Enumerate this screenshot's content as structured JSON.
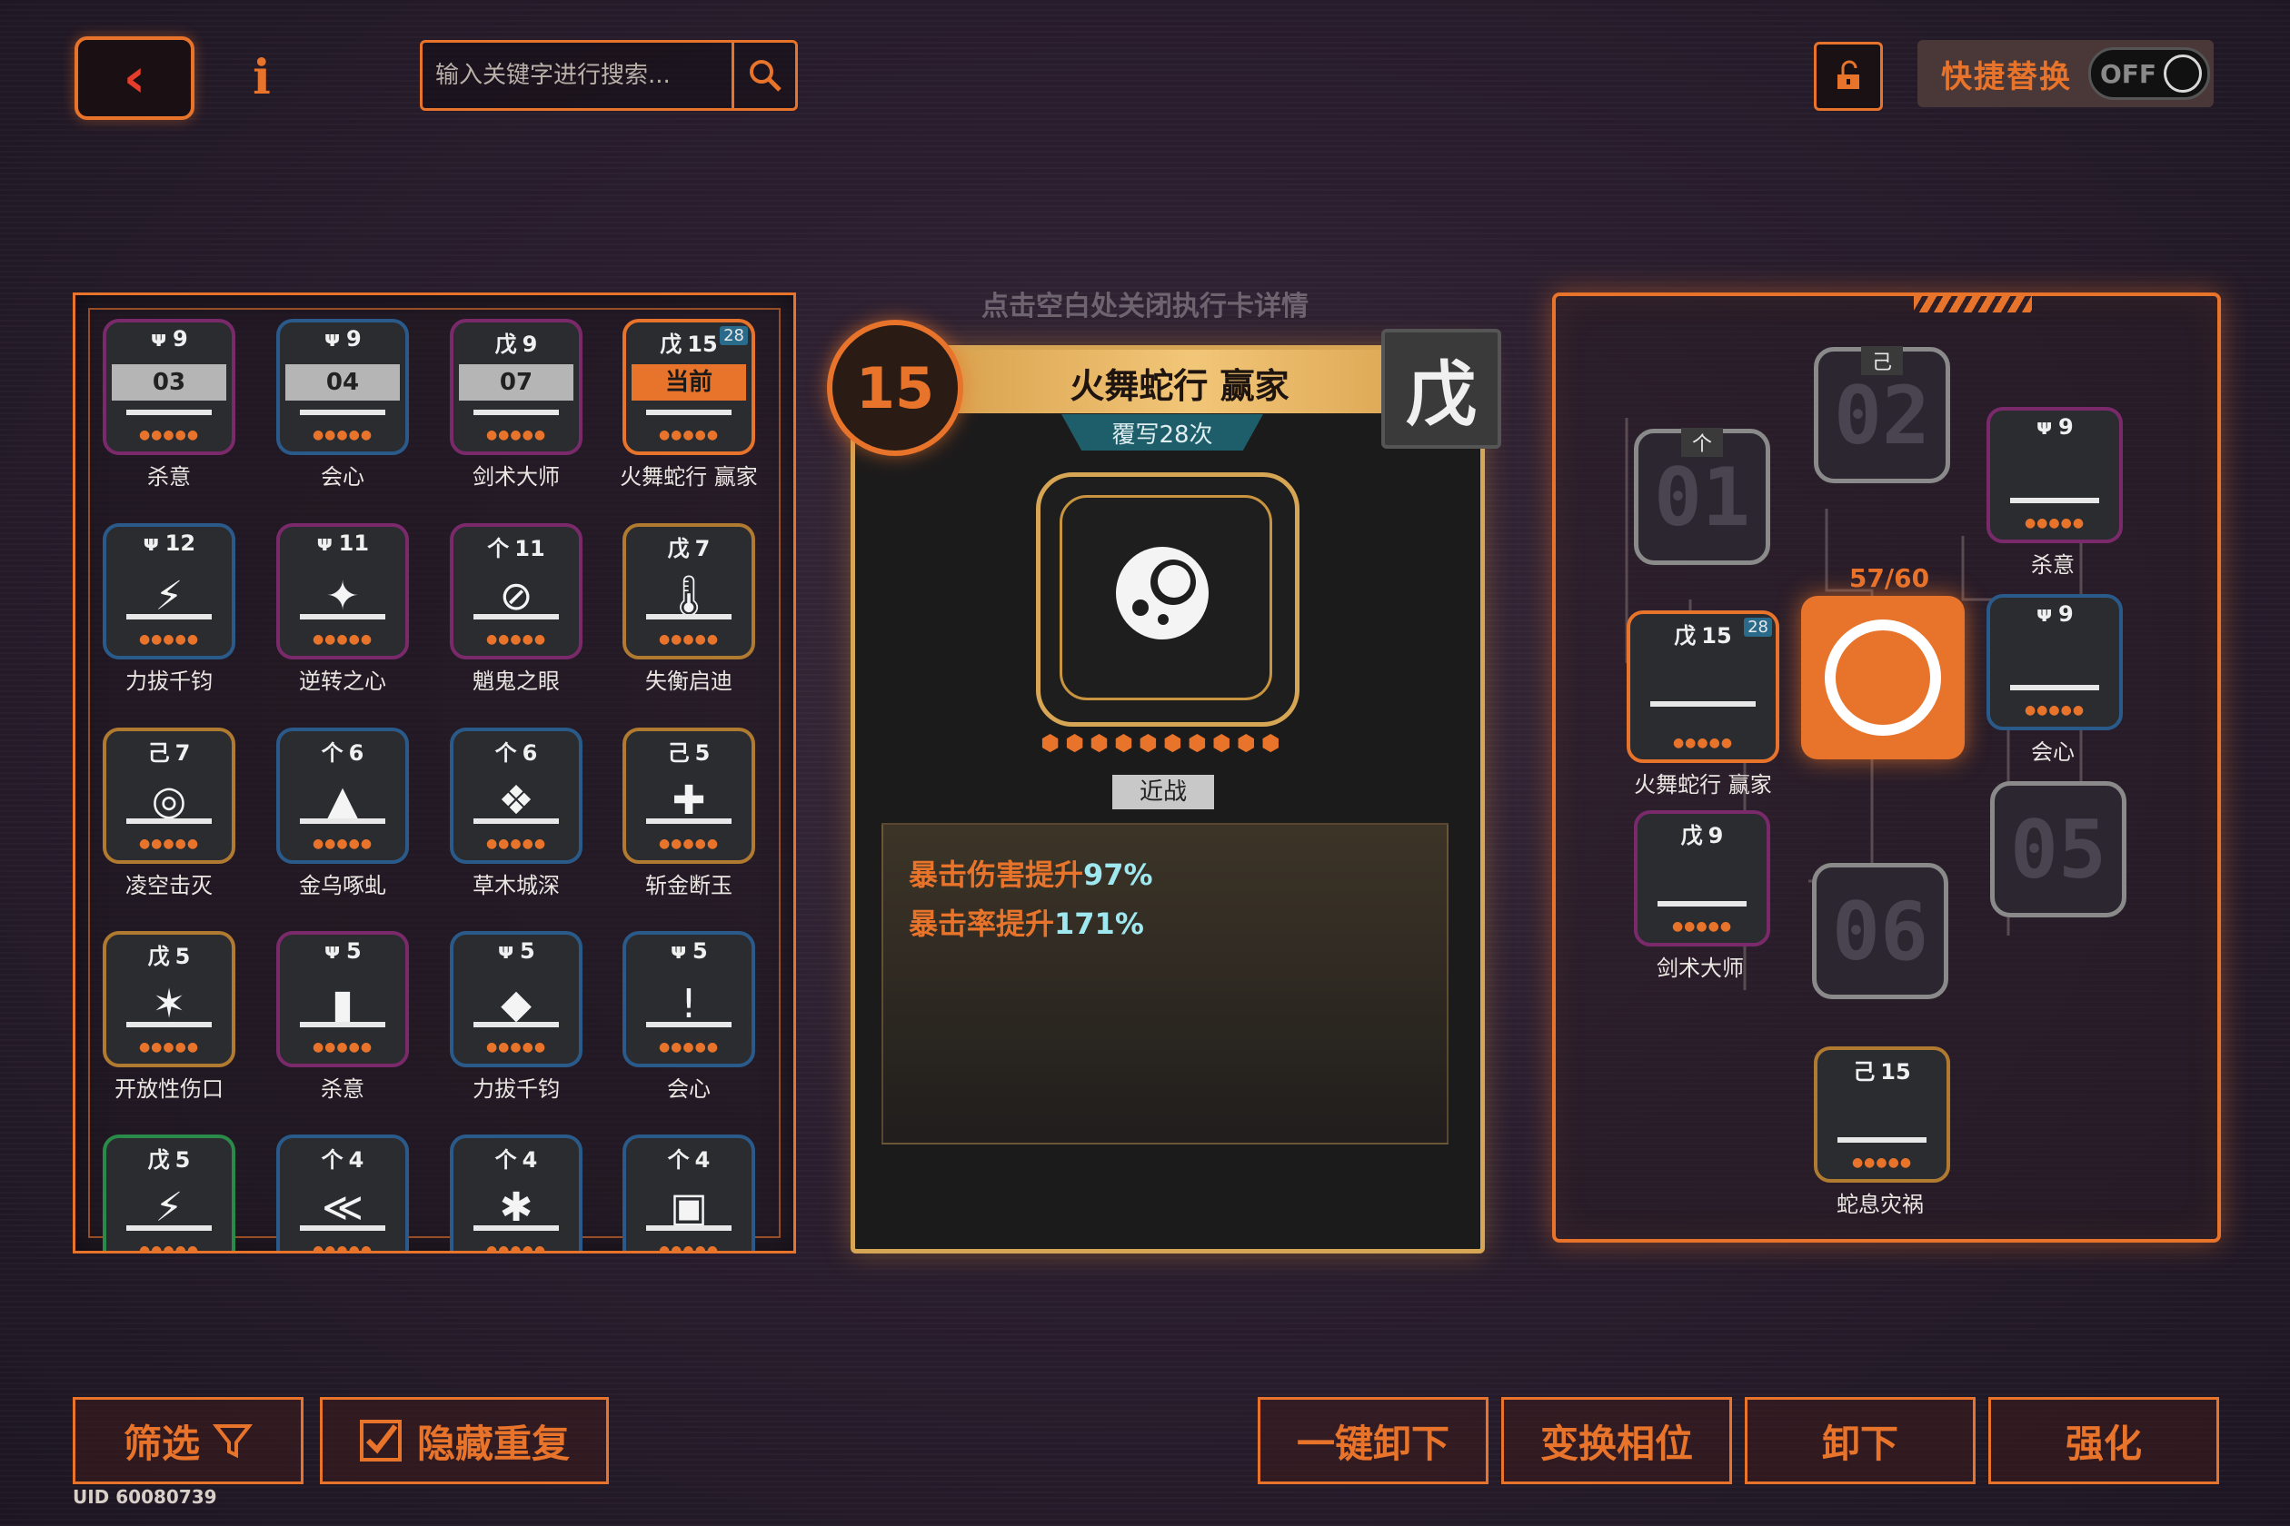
{
  "topbar": {
    "search_placeholder": "输入关键字进行搜索...",
    "quick_replace_label": "快捷替换",
    "toggle_state": "OFF"
  },
  "hint": "点击空白处关闭执行卡详情",
  "inventory": [
    {
      "phase": "ᴪ",
      "level": "9",
      "band": "03",
      "name": "杀意",
      "color": "#7a2a6a"
    },
    {
      "phase": "ᴪ",
      "level": "9",
      "band": "04",
      "name": "会心",
      "color": "#2a5a8a"
    },
    {
      "phase": "戊",
      "level": "9",
      "band": "07",
      "name": "剑术大师",
      "color": "#7a2a6a"
    },
    {
      "phase": "戊",
      "level": "15",
      "band": "当前",
      "name": "火舞蛇行 赢家",
      "color": "#e8732a",
      "badge": "28"
    },
    {
      "phase": "ᴪ",
      "level": "12",
      "glyph": "⚡",
      "name": "力拔千钧",
      "color": "#2a5a8a"
    },
    {
      "phase": "ᴪ",
      "level": "11",
      "glyph": "✦",
      "name": "逆转之心",
      "color": "#7a2a6a"
    },
    {
      "phase": "个",
      "level": "11",
      "glyph": "⊘",
      "name": "魈鬼之眼",
      "color": "#7a2a6a"
    },
    {
      "phase": "戊",
      "level": "7",
      "glyph": "🌡",
      "name": "失衡启迪",
      "color": "#b07a30"
    },
    {
      "phase": "己",
      "level": "7",
      "glyph": "◎",
      "name": "凌空击灭",
      "color": "#b07a30"
    },
    {
      "phase": "个",
      "level": "6",
      "glyph": "▲",
      "name": "金乌啄虬",
      "color": "#2a5a8a"
    },
    {
      "phase": "个",
      "level": "6",
      "glyph": "❖",
      "name": "草木城深",
      "color": "#2a5a8a"
    },
    {
      "phase": "己",
      "level": "5",
      "glyph": "✚",
      "name": "斩金断玉",
      "color": "#b07a30"
    },
    {
      "phase": "戊",
      "level": "5",
      "glyph": "✶",
      "name": "开放性伤口",
      "color": "#b07a30"
    },
    {
      "phase": "ᴪ",
      "level": "5",
      "glyph": "▮",
      "name": "杀意",
      "color": "#7a2a6a"
    },
    {
      "phase": "ᴪ",
      "level": "5",
      "glyph": "◆",
      "name": "力拔千钧",
      "color": "#2a5a8a"
    },
    {
      "phase": "ᴪ",
      "level": "5",
      "glyph": "!",
      "name": "会心",
      "color": "#2a5a8a"
    },
    {
      "phase": "戊",
      "level": "5",
      "glyph": "⚡",
      "name": "",
      "color": "#2a8a4a"
    },
    {
      "phase": "个",
      "level": "4",
      "glyph": "≪",
      "name": "",
      "color": "#2a5a8a"
    },
    {
      "phase": "个",
      "level": "4",
      "glyph": "✱",
      "name": "",
      "color": "#2a5a8a"
    },
    {
      "phase": "个",
      "level": "4",
      "glyph": "▣",
      "name": "",
      "color": "#2a5a8a"
    }
  ],
  "detail": {
    "level": "15",
    "title": "火舞蛇行 赢家",
    "subtitle": "覆写28次",
    "phase": "戊",
    "tag": "近战",
    "effects": [
      {
        "label": "暴击伤害提升",
        "value": "97%"
      },
      {
        "label": "暴击率提升",
        "value": "171%"
      }
    ]
  },
  "loadout": {
    "energy": "57/60",
    "slots": [
      {
        "id": "01",
        "phase": "个",
        "name": ""
      },
      {
        "id": "02",
        "phase": "己",
        "name": ""
      },
      {
        "id": "05",
        "phase": "",
        "name": ""
      },
      {
        "id": "06",
        "phase": "",
        "name": ""
      }
    ],
    "equipped": [
      {
        "phase": "ᴪ",
        "level": "9",
        "name": "杀意"
      },
      {
        "phase": "ᴪ",
        "level": "9",
        "name": "会心"
      },
      {
        "phase": "戊",
        "level": "15",
        "name": "火舞蛇行 赢家",
        "badge": "28"
      },
      {
        "phase": "戊",
        "level": "9",
        "name": "剑术大师"
      },
      {
        "phase": "己",
        "level": "15",
        "name": "蛇息灾祸"
      }
    ]
  },
  "bottom": {
    "filter": "筛选",
    "hide_dup": "隐藏重复",
    "unload_all": "一键卸下",
    "swap_phase": "变换相位",
    "unload": "卸下",
    "enhance": "强化",
    "uid": "UID 60080739"
  },
  "colors": {
    "accent": "#e8732a",
    "gold": "#d7a655",
    "effect_value": "#9fe8f0"
  }
}
